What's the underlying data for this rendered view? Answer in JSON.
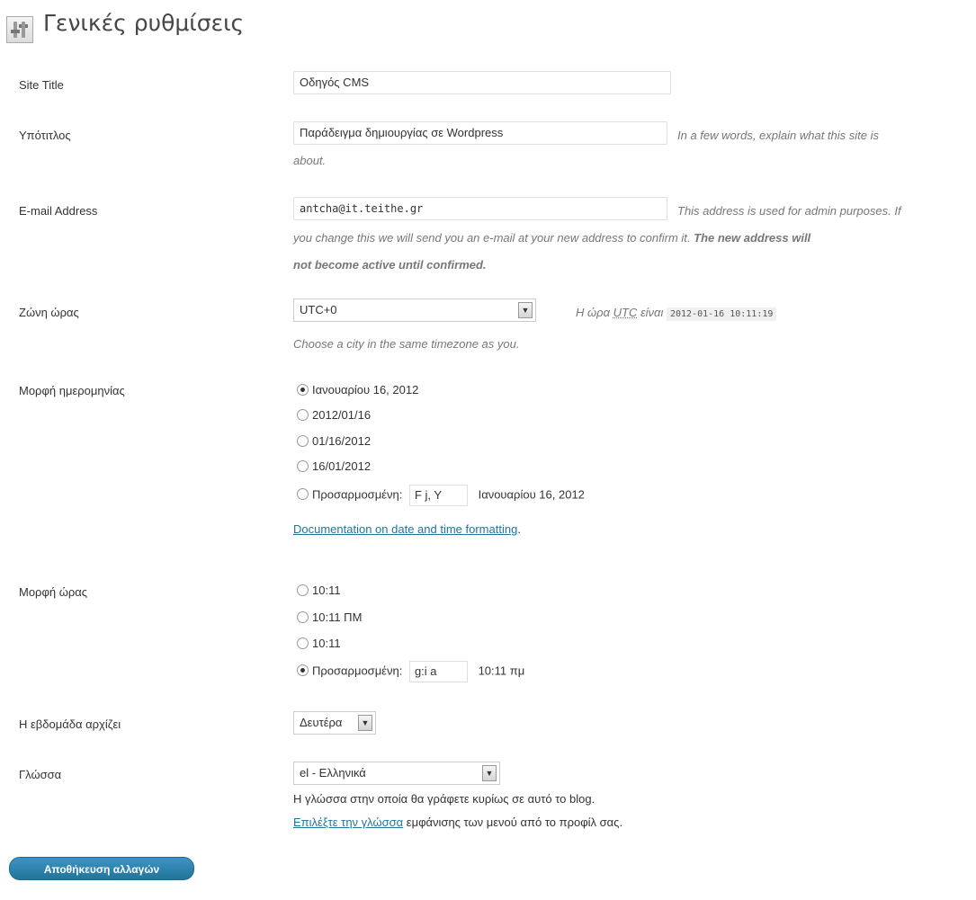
{
  "page": {
    "title": "Γενικές ρυθμίσεις"
  },
  "site_title": {
    "label": "Site Title",
    "value": "Οδηγός CMS"
  },
  "tagline": {
    "label": "Υπότιτλος",
    "value": "Παράδειγμα δημιουργίας σε Wordpress",
    "desc_line1": "In a few words, explain what this site is",
    "desc_line2": "about."
  },
  "email": {
    "label": "E-mail Address",
    "value": "antcha@it.teithe.gr",
    "desc_line1": "This address is used for admin purposes. If",
    "desc_line2": "you change this we will send you an e-mail at your new address to confirm it.",
    "desc_bold_a": "The new address will",
    "desc_bold_b": "not become active until confirmed."
  },
  "timezone": {
    "label": "Ζώνη ώρας",
    "selected": "UTC+0",
    "utc_prefix": "Η ώρα",
    "utc_abbr": "UTC",
    "utc_suffix": "είναι",
    "utc_time": "2012-01-16 10:11:19",
    "desc": "Choose a city in the same timezone as you."
  },
  "date_format": {
    "label": "Μορφή ημερομηνίας",
    "options": [
      {
        "text": "Ιανουαρίου 16, 2012",
        "checked": true
      },
      {
        "text": "2012/01/16",
        "checked": false
      },
      {
        "text": "01/16/2012",
        "checked": false
      },
      {
        "text": "16/01/2012",
        "checked": false
      }
    ],
    "custom_label": "Προσαρμοσμένη:",
    "custom_value": "F j, Y",
    "custom_preview": "Ιανουαρίου 16, 2012",
    "doc_link": "Documentation on date and time formatting",
    "doc_period": "."
  },
  "time_format": {
    "label": "Μορφή ώρας",
    "options": [
      {
        "text": "10:11",
        "checked": false
      },
      {
        "text": "10:11 ΠΜ",
        "checked": false
      },
      {
        "text": "10:11",
        "checked": false
      }
    ],
    "custom_label": "Προσαρμοσμένη:",
    "custom_value": "g:i a",
    "custom_preview": "10:11 πμ"
  },
  "week_start": {
    "label": "Η εβδομάδα αρχίζει",
    "selected": "Δευτέρα"
  },
  "language": {
    "label": "Γλώσσα",
    "selected": "el - Ελληνικά",
    "desc_line1": "Η γλώσσα στην οποία θα γράφετε κυρίως σε αυτό το blog.",
    "desc_link": "Επιλέξτε την γλώσσα",
    "desc_line2_rest": " εμφάνισης των μενού από το προφίλ σας."
  },
  "save_button": "Αποθήκευση αλλαγών",
  "icons": {
    "title": "settings-icon",
    "dropdown": "chevron-down-icon"
  },
  "colors": {
    "link": "#21759b",
    "button": "#21759b"
  }
}
